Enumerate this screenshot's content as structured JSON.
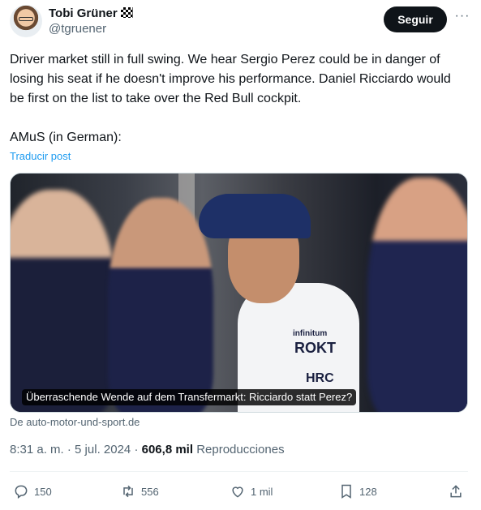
{
  "author": {
    "display_name": "Tobi Grüner",
    "handle": "@tgruener",
    "follow_label": "Seguir"
  },
  "tweet": {
    "text": "Driver market still in full swing. We hear Sergio Perez could be in danger of losing his seat if he doesn't improve his performance. Daniel Ricciardo would be first on the list to take over the Red Bull cockpit.",
    "source_line": "AMuS (in German):",
    "translate_label": "Traducir post"
  },
  "media": {
    "caption": "Überraschende Wende auf dem Transfermarkt: Ricciardo statt Perez?",
    "domain": "De auto-motor-und-sport.de",
    "sponsor_texts": [
      "infinitum",
      "ROKT",
      "HRC"
    ]
  },
  "meta": {
    "time": "8:31 a. m.",
    "separator": " · ",
    "date": "5 jul. 2024",
    "views_count": "606,8 mil",
    "views_label": "Reproducciones"
  },
  "actions": {
    "reply_count": "150",
    "retweet_count": "556",
    "like_count": "1 mil",
    "bookmark_count": "128"
  },
  "icons": [
    "checkered-flag-icon",
    "more-icon",
    "reply-icon",
    "retweet-icon",
    "like-icon",
    "bookmark-icon",
    "share-icon"
  ]
}
